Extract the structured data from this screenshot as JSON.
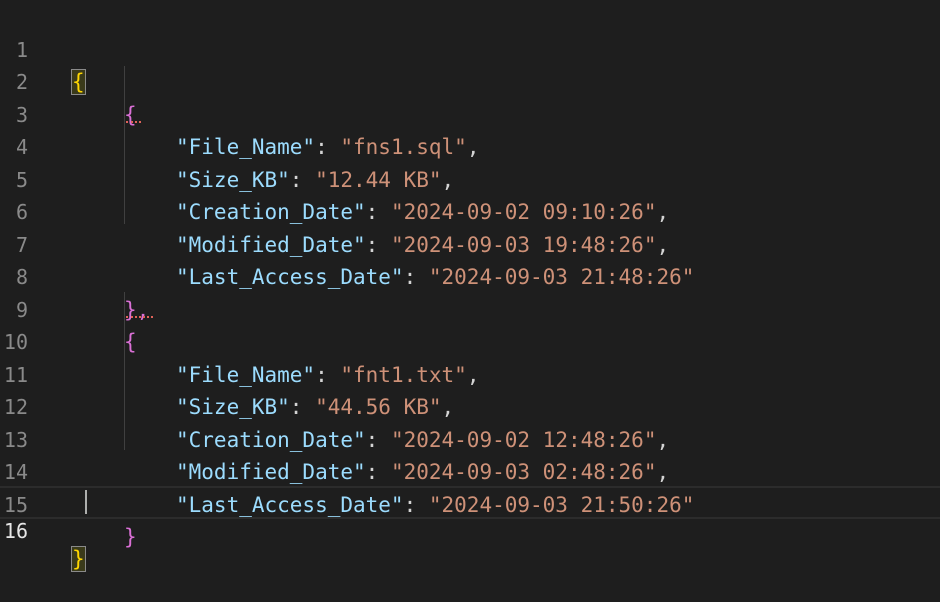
{
  "editor": {
    "line_numbers": [
      "1",
      "2",
      "3",
      "4",
      "5",
      "6",
      "7",
      "8",
      "9",
      "10",
      "11",
      "12",
      "13",
      "14",
      "15",
      "16"
    ],
    "brace_open": "{",
    "brace_close": "}",
    "brace_close_comma": "},",
    "records": [
      {
        "file_name_key": "\"File_Name\"",
        "file_name_val": "\"fns1.sql\"",
        "size_key": "\"Size_KB\"",
        "size_val": "\"12.44 KB\"",
        "creation_key": "\"Creation_Date\"",
        "creation_val": "\"2024-09-02 09:10:26\"",
        "modified_key": "\"Modified_Date\"",
        "modified_val": "\"2024-09-03 19:48:26\"",
        "access_key": "\"Last_Access_Date\"",
        "access_val": "\"2024-09-03 21:48:26\""
      },
      {
        "file_name_key": "\"File_Name\"",
        "file_name_val": "\"fnt1.txt\"",
        "size_key": "\"Size_KB\"",
        "size_val": "\"44.56 KB\"",
        "creation_key": "\"Creation_Date\"",
        "creation_val": "\"2024-09-02 12:48:26\"",
        "modified_key": "\"Modified_Date\"",
        "modified_val": "\"2024-09-03 02:48:26\"",
        "access_key": "\"Last_Access_Date\"",
        "access_val": "\"2024-09-03 21:50:26\""
      }
    ],
    "colors": {
      "background": "#1e1e1e",
      "key": "#9cdcfe",
      "string": "#ce9178",
      "brace_level1": "#ffd700",
      "brace_level2": "#da70d6",
      "line_number": "#8a8a8a"
    }
  }
}
